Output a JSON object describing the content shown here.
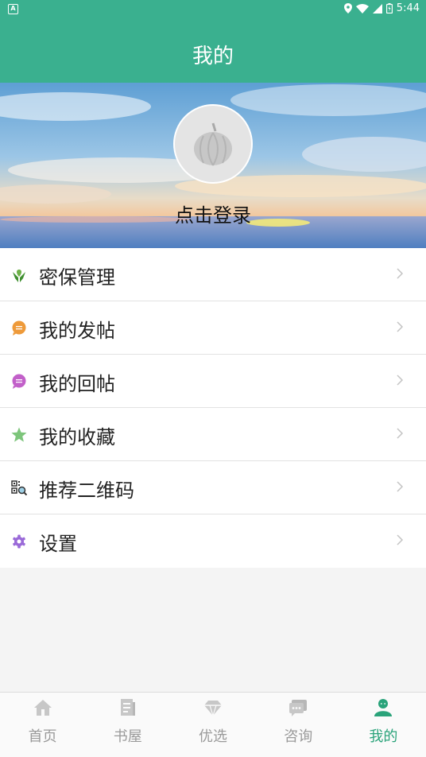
{
  "status_bar": {
    "time": "5:44"
  },
  "app_bar": {
    "title": "我的"
  },
  "profile": {
    "login_label": "点击登录"
  },
  "menu": [
    {
      "label": "密保管理",
      "icon": "security-hands-icon",
      "color": "#3f8f2f"
    },
    {
      "label": "我的发帖",
      "icon": "post-bubble-icon",
      "color": "#ee9a3a"
    },
    {
      "label": "我的回帖",
      "icon": "reply-bubble-icon",
      "color": "#c260c9"
    },
    {
      "label": "我的收藏",
      "icon": "star-icon",
      "color": "#7dc57b"
    },
    {
      "label": "推荐二维码",
      "icon": "qrcode-icon",
      "color": "#3a3a3a"
    },
    {
      "label": "设置",
      "icon": "gear-icon",
      "color": "#9a6ad8"
    }
  ],
  "bottom_nav": [
    {
      "label": "首页",
      "icon": "home-icon",
      "active": false
    },
    {
      "label": "书屋",
      "icon": "book-icon",
      "active": false
    },
    {
      "label": "优选",
      "icon": "diamond-icon",
      "active": false
    },
    {
      "label": "咨询",
      "icon": "chat-icon",
      "active": false
    },
    {
      "label": "我的",
      "icon": "person-icon",
      "active": true
    }
  ],
  "colors": {
    "accent": "#3ab08f",
    "active_nav": "#2aa37a",
    "inactive_nav": "#9a9a9a"
  }
}
